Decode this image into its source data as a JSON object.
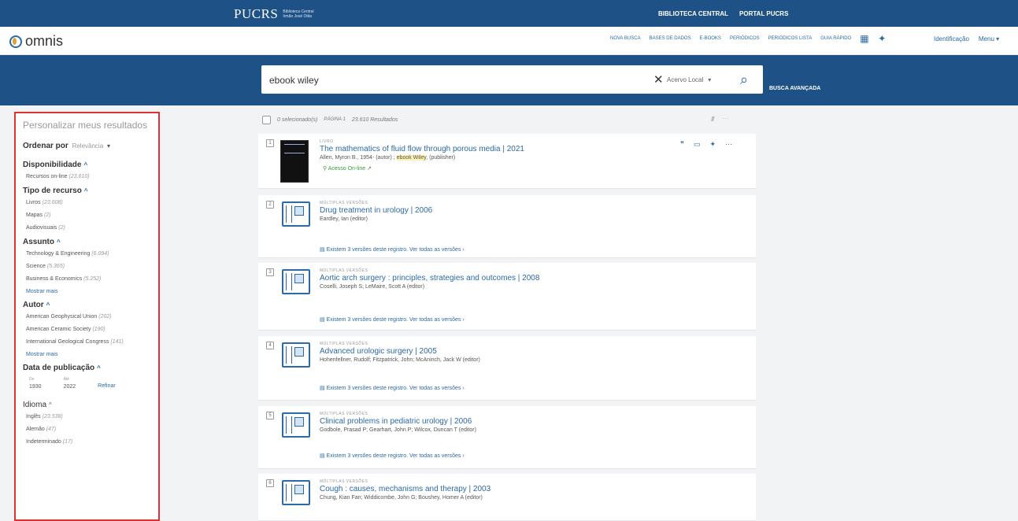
{
  "topbar": {
    "brand": "PUCRS",
    "brand_sub_1": "Biblioteca Central",
    "brand_sub_2": "Irmão José Otão",
    "links": [
      "BIBLIOTECA CENTRAL",
      "PORTAL PUCRS"
    ]
  },
  "nav": {
    "logo": "omnis",
    "links": [
      "NOVA BUSCA",
      "BASES DE DADOS",
      "E-BOOKS",
      "PERIÓDICOS",
      "PERIÓDICOS LISTA",
      "GUIA RÁPIDO"
    ],
    "signin": "Identificação",
    "menu": "Menu"
  },
  "search": {
    "query": "ebook wiley",
    "scope": "Acervo Local",
    "advanced": "BUSCA AVANÇADA"
  },
  "results_header": {
    "selected": "0 selecionado(s)",
    "page": "PÁGINA 1",
    "count": "23.610 Resultados"
  },
  "sidebar": {
    "title": "Personalizar meus resultados",
    "sort_label": "Ordenar por",
    "sort_value": "Relevância",
    "availability": {
      "heading": "Disponibilidade",
      "items": [
        {
          "label": "Recursos on-line",
          "count": "(23.610)"
        }
      ]
    },
    "resource_type": {
      "heading": "Tipo de recurso",
      "items": [
        {
          "label": "Livros",
          "count": "(23.608)"
        },
        {
          "label": "Mapas",
          "count": "(2)"
        },
        {
          "label": "Audiovisuais",
          "count": "(2)"
        }
      ]
    },
    "subject": {
      "heading": "Assunto",
      "items": [
        {
          "label": "Technology & Engineering",
          "count": "(6.094)"
        },
        {
          "label": "Science",
          "count": "(5.365)"
        },
        {
          "label": "Business & Economics",
          "count": "(5.252)"
        }
      ],
      "more": "Mostrar mais"
    },
    "author": {
      "heading": "Autor",
      "items": [
        {
          "label": "American Geophysical Union",
          "count": "(202)"
        },
        {
          "label": "American Ceramic Society",
          "count": "(190)"
        },
        {
          "label": "International Geological Congress",
          "count": "(141)"
        }
      ],
      "more": "Mostrar mais"
    },
    "pubdate": {
      "heading": "Data de publicação",
      "from_label": "De",
      "to_label": "Até",
      "from": "1930",
      "to": "2022",
      "refine": "Refinar"
    },
    "language": {
      "heading": "Idioma",
      "items": [
        {
          "label": "Inglês",
          "count": "(23.538)"
        },
        {
          "label": "Alemão",
          "count": "(47)"
        },
        {
          "label": "Indeterminado",
          "count": "(17)"
        }
      ]
    }
  },
  "results": [
    {
      "num": "1",
      "type": "LIVRO",
      "title": "The mathematics of fluid flow through porous media | 2021",
      "author_pre": "Allen, Myron B., 1954- (autor) ; ",
      "author_hl": "ebook Wiley",
      "author_post": ", (publisher)",
      "access": "Acesso On-line",
      "versions": ""
    },
    {
      "num": "2",
      "type": "MÚLTIPLAS VERSÕES",
      "title": "Drug treatment in urology | 2006",
      "author_pre": "Eardley, Ian (editor)",
      "author_hl": "",
      "author_post": "",
      "access": "",
      "versions": "Existem 3 versões deste registro. Ver todas as versões"
    },
    {
      "num": "3",
      "type": "MÚLTIPLAS VERSÕES",
      "title": "Aortic arch surgery : principles, strategies and outcomes | 2008",
      "author_pre": "Coselli, Joseph S; LeMaire, Scott A (editor)",
      "author_hl": "",
      "author_post": "",
      "access": "",
      "versions": "Existem 3 versões deste registro. Ver todas as versões"
    },
    {
      "num": "4",
      "type": "MÚLTIPLAS VERSÕES",
      "title": "Advanced urologic surgery | 2005",
      "author_pre": "Hohenfellner, Rudolf; Fitzpatrick, John; McAninch, Jack W (editor)",
      "author_hl": "",
      "author_post": "",
      "access": "",
      "versions": "Existem 3 versões deste registro. Ver todas as versões"
    },
    {
      "num": "5",
      "type": "MÚLTIPLAS VERSÕES",
      "title": "Clinical problems in pediatric urology | 2006",
      "author_pre": "Godbole, Prasad P; Gearhart, John P; Wilcox, Duncan T (editor)",
      "author_hl": "",
      "author_post": "",
      "access": "",
      "versions": "Existem 3 versões deste registro. Ver todas as versões"
    },
    {
      "num": "6",
      "type": "MÚLTIPLAS VERSÕES",
      "title": "Cough : causes, mechanisms and therapy | 2003",
      "author_pre": "Chung, Kian Fan; Widdicombe, John G; Boushey, Homer A (editor)",
      "author_hl": "",
      "author_post": "",
      "access": "",
      "versions": ""
    }
  ]
}
